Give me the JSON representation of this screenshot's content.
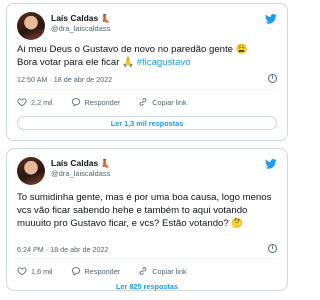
{
  "tweets": [
    {
      "name": "Laís Caldas",
      "name_emoji": "👢",
      "handle": "@dra_laiscaldass",
      "text_lines": [
        "Ai meu Deus o Gustavo de novo no paredão gente 😩",
        "Bora votar para ele ficar 🙏 "
      ],
      "hashtag": "#ficagustavo",
      "time": "12:50 AM · 18 de abr de 2022",
      "likes": "2,2 mil",
      "reply_label": "Responder",
      "copy_label": "Copiar link",
      "replies_button": "Ler 1,3 mil respostas"
    },
    {
      "name": "Laís Caldas",
      "name_emoji": "👢",
      "handle": "@dra_laiscaldass",
      "text": "To sumidinha gente, mas é por uma boa causa, logo menos vcs vão ficar sabendo hehe e também to aqui votando muuuito pro Gustavo ficar, e vcs? Estão votando? 🤔",
      "time": "6:24 PM · 18 de abr de 2022",
      "likes": "1,6 mil",
      "reply_label": "Responder",
      "copy_label": "Copiar link",
      "replies_button": "Ler 825 respostas"
    }
  ],
  "colors": {
    "accent": "#1d9bf0",
    "like": "#536471",
    "border": "#cfd9de"
  }
}
